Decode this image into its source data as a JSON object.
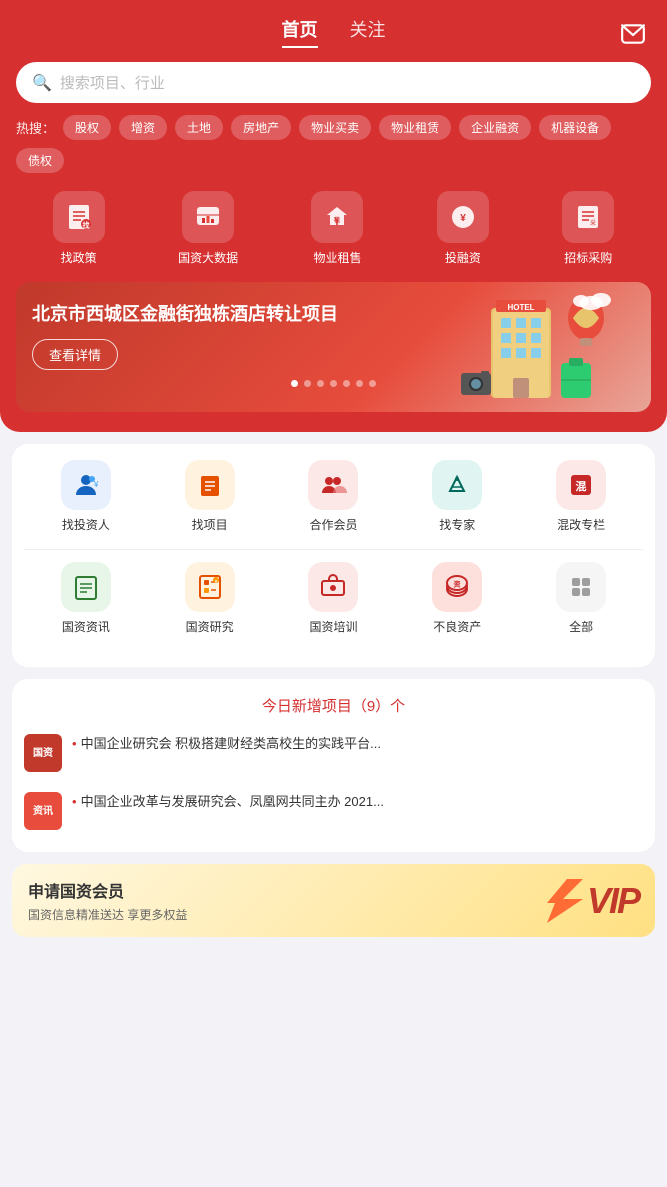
{
  "header": {
    "tabs": [
      {
        "label": "首页",
        "active": true
      },
      {
        "label": "关注",
        "active": false
      }
    ],
    "msg_icon": "message-icon"
  },
  "search": {
    "placeholder": "搜索项目、行业"
  },
  "hot_search": {
    "label": "热搜：",
    "tags": [
      "股权",
      "增资",
      "土地",
      "房地产",
      "物业买卖",
      "物业租赁",
      "企业融资",
      "机器设备",
      "债权"
    ]
  },
  "top_menu": [
    {
      "icon": "📋",
      "label": "找政策"
    },
    {
      "icon": "🏛",
      "label": "国资大数据"
    },
    {
      "icon": "🏠",
      "label": "物业租售"
    },
    {
      "icon": "💰",
      "label": "投融资"
    },
    {
      "icon": "📢",
      "label": "招标采购"
    }
  ],
  "banner": {
    "title": "北京市西城区金融街独栋酒店转让项目",
    "btn_label": "查看详情",
    "dots": 7,
    "active_dot": 0
  },
  "second_menu_row1": [
    {
      "icon": "👤",
      "label": "找投资人",
      "color": "blue"
    },
    {
      "icon": "📁",
      "label": "找项目",
      "color": "orange"
    },
    {
      "icon": "🤝",
      "label": "合作会员",
      "color": "red"
    },
    {
      "icon": "🎓",
      "label": "找专家",
      "color": "teal"
    },
    {
      "icon": "🔖",
      "label": "混改专栏",
      "color": "pink"
    }
  ],
  "second_menu_row2": [
    {
      "icon": "📰",
      "label": "国资资讯",
      "color": "green"
    },
    {
      "icon": "📊",
      "label": "国资研究",
      "color": "orange"
    },
    {
      "icon": "🎓",
      "label": "国资培训",
      "color": "red"
    },
    {
      "icon": "⚠️",
      "label": "不良资产",
      "color": "dark-red"
    },
    {
      "icon": "⚙️",
      "label": "全部",
      "color": "gray"
    }
  ],
  "today_count": {
    "text": "今日新增项目（9）个"
  },
  "news_items": [
    {
      "badge_line1": "国资",
      "badge_line2": "",
      "badge_type": "guozi",
      "text": "中国企业研究会 积极搭建财经类高校生的实践平台..."
    },
    {
      "badge_line1": "资讯",
      "badge_line2": "",
      "badge_type": "zixun",
      "text": "中国企业改革与发展研究会、凤凰网共同主办 2021..."
    }
  ],
  "vip_banner": {
    "title": "申请国资会员",
    "subtitle": "国资信息精准送达 享更多权益",
    "vip_label": "VIP"
  }
}
